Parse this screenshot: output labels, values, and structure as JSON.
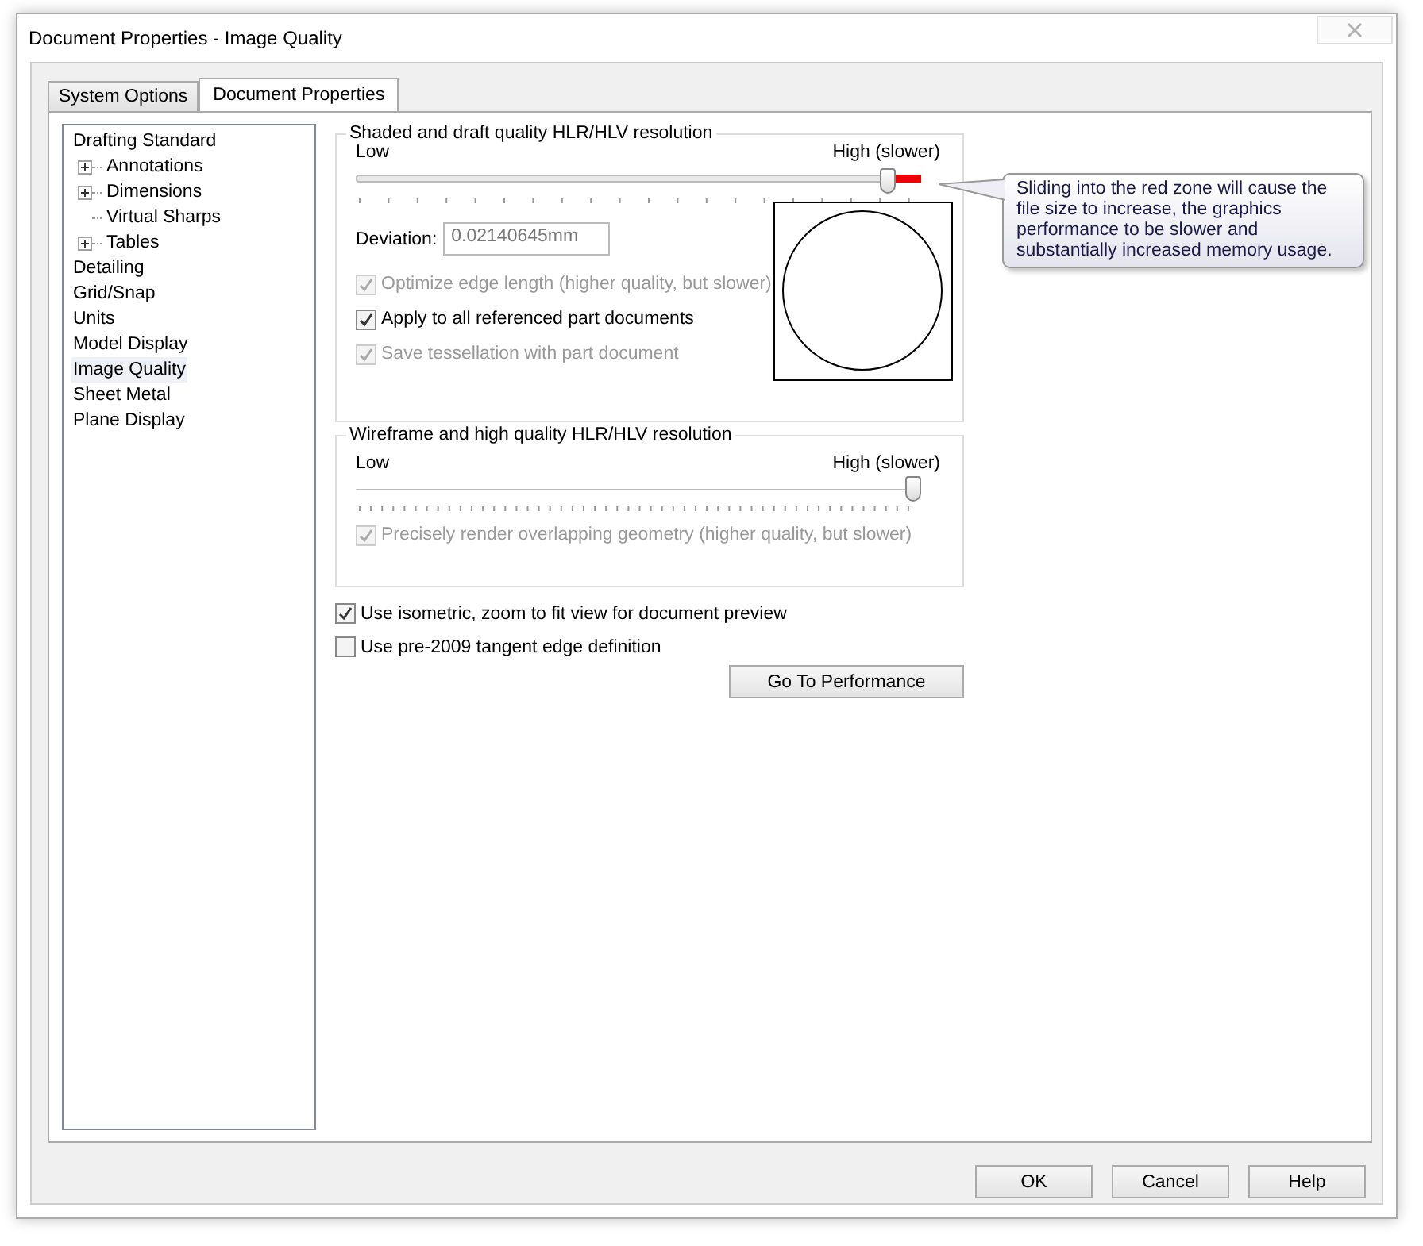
{
  "window": {
    "title": "Document Properties - Image Quality"
  },
  "tabs": [
    {
      "label": "System Options",
      "selected": false
    },
    {
      "label": "Document Properties",
      "selected": true
    }
  ],
  "tree": [
    {
      "label": "Drafting Standard",
      "selected": false,
      "children": [
        {
          "label": "Annotations",
          "expanded": false,
          "has_children": true,
          "selected": false
        },
        {
          "label": "Dimensions",
          "expanded": false,
          "has_children": true,
          "selected": false
        },
        {
          "label": "Virtual Sharps",
          "has_children": false,
          "selected": false
        },
        {
          "label": "Tables",
          "expanded": false,
          "has_children": true,
          "selected": false
        }
      ]
    },
    {
      "label": "Detailing",
      "selected": false
    },
    {
      "label": "Grid/Snap",
      "selected": false
    },
    {
      "label": "Units",
      "selected": false
    },
    {
      "label": "Model Display",
      "selected": false
    },
    {
      "label": "Image Quality",
      "selected": true
    },
    {
      "label": "Sheet Metal",
      "selected": false
    },
    {
      "label": "Plane Display",
      "selected": false
    }
  ],
  "shaded_group": {
    "title": "Shaded and draft quality HLR/HLV resolution",
    "low_label": "Low",
    "high_label": "High (slower)",
    "level": 0.94,
    "red_zone": true,
    "deviation_label": "Deviation:",
    "deviation_value": "0.02140645mm",
    "options": [
      {
        "label": "Optimize edge length (higher quality, but slower)",
        "checked": true,
        "disabled": true
      },
      {
        "label": "Apply to all referenced part documents",
        "checked": true,
        "disabled": false
      },
      {
        "label": "Save tessellation with part document",
        "checked": true,
        "disabled": true
      }
    ]
  },
  "tooltip": "Sliding into the red zone will cause the file size to increase, the graphics performance to be slower and substantially increased memory usage.",
  "wireframe_group": {
    "title": "Wireframe and high quality HLR/HLV resolution",
    "low_label": "Low",
    "high_label": "High (slower)",
    "level": 1.0,
    "red_zone": false,
    "options": [
      {
        "label": "Precisely render overlapping geometry (higher quality, but slower)",
        "checked": true,
        "disabled": true
      }
    ]
  },
  "options": [
    {
      "label": "Use isometric, zoom to fit view for document preview",
      "checked": true,
      "disabled": false
    },
    {
      "label": "Use pre-2009 tangent edge definition",
      "checked": false,
      "disabled": false
    }
  ],
  "performance_button": "Go To Performance",
  "buttons": [
    "OK",
    "Cancel",
    "Help"
  ]
}
